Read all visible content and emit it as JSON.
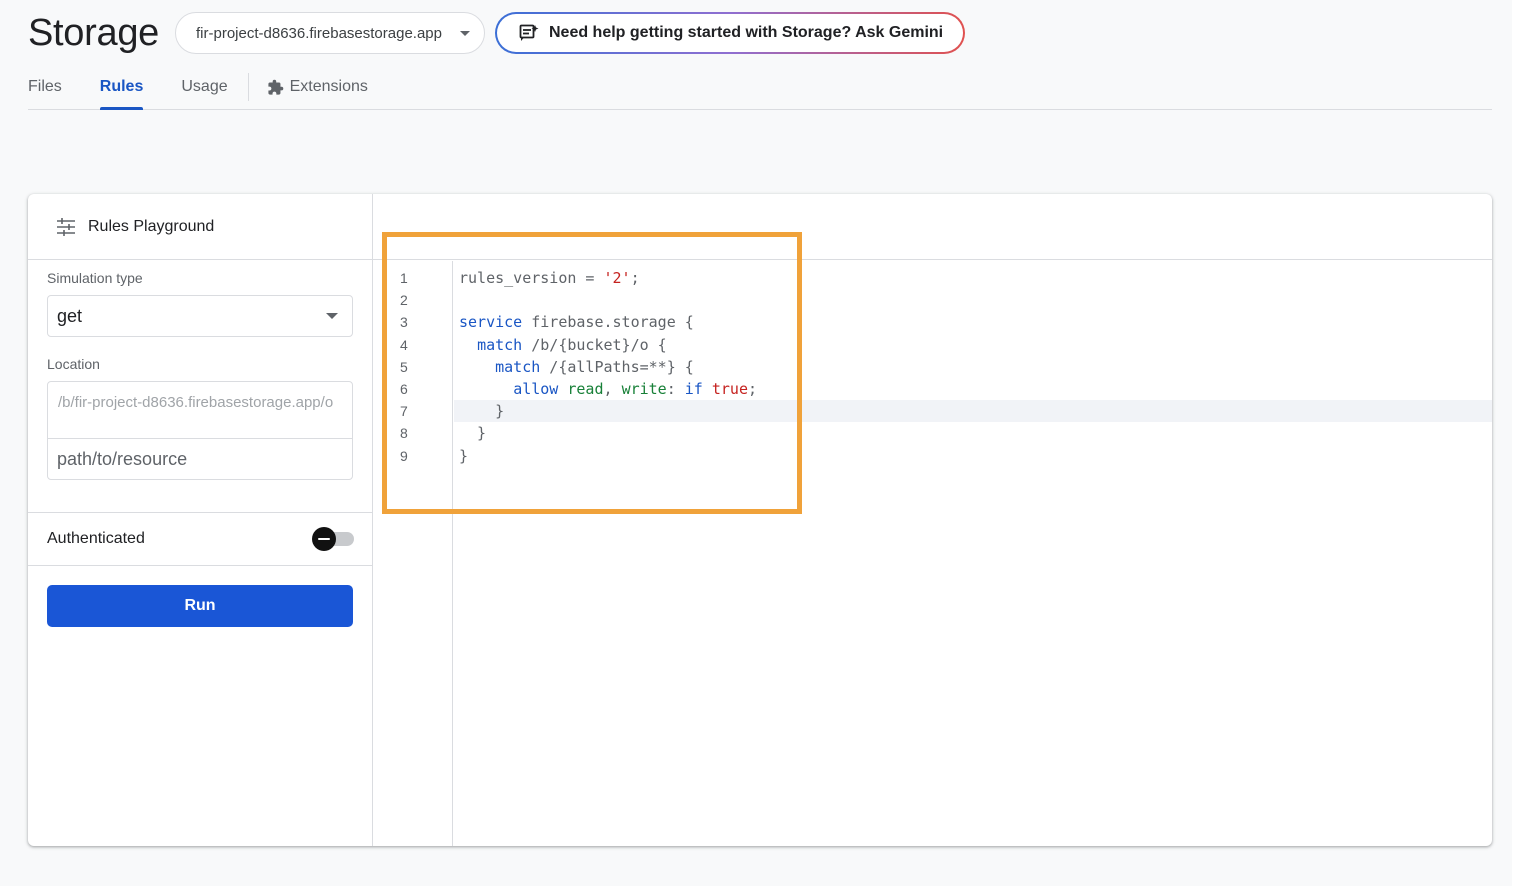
{
  "header": {
    "title": "Storage",
    "bucket": "fir-project-d8636.firebasestorage.app",
    "gemini_label": "Need help getting started with Storage? Ask Gemini"
  },
  "tabs": [
    {
      "label": "Files",
      "active": false
    },
    {
      "label": "Rules",
      "active": true
    },
    {
      "label": "Usage",
      "active": false
    },
    {
      "label": "Extensions",
      "active": false
    }
  ],
  "playground": {
    "title": "Rules Playground",
    "simulation_type_label": "Simulation type",
    "simulation_type_value": "get",
    "location_label": "Location",
    "location_prefix": "/b/fir-project-d8636.firebasestorage.app/o",
    "location_path_placeholder": "path/to/resource",
    "authenticated_label": "Authenticated",
    "authenticated": false,
    "run_label": "Run"
  },
  "editor": {
    "line_numbers": [
      "1",
      "2",
      "3",
      "4",
      "5",
      "6",
      "7",
      "8",
      "9"
    ],
    "highlighted_line": 7,
    "lines": [
      "rules_version = '2';",
      "",
      "service firebase.storage {",
      "  match /b/{bucket}/o {",
      "    match /{allPaths=**} {",
      "      allow read, write: if true;",
      "    }",
      "  }",
      "}"
    ]
  },
  "colors": {
    "accent": "#1a56c4",
    "run_button": "#1a56d6",
    "highlight_box": "#f0a23a",
    "string": "#c5221f",
    "keyword": "#1a56c4",
    "identifier": "#188038"
  }
}
